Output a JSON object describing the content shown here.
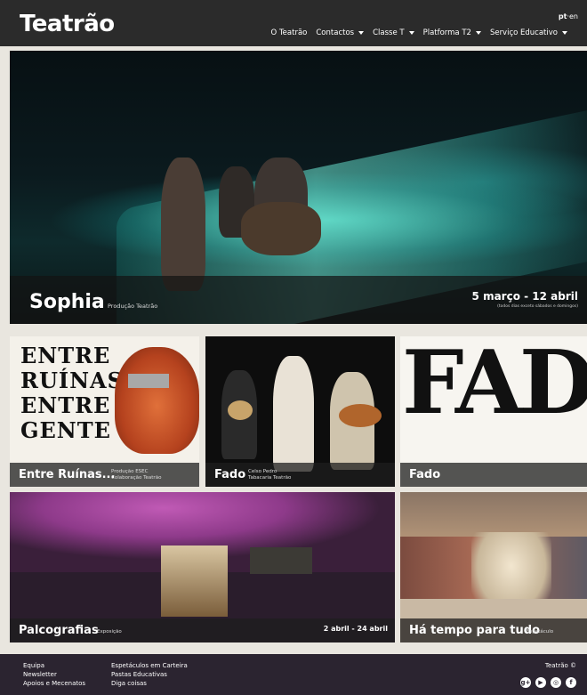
{
  "header": {
    "logo": "Teatrão",
    "lang_active": "pt",
    "lang_sep": "·",
    "lang_other": "en",
    "nav": [
      {
        "label": "O Teatrão",
        "dropdown": false
      },
      {
        "label": "Contactos",
        "dropdown": true
      },
      {
        "label": "Classe T",
        "dropdown": true
      },
      {
        "label": "Platforma T2",
        "dropdown": true
      },
      {
        "label": "Serviço Educativo",
        "dropdown": true
      }
    ]
  },
  "hero": {
    "title": "Sophia",
    "subtitle": "Produção Teatrão",
    "dates": "5 março - 12 abril",
    "note": "(todos dias exceto sábados e domingos)"
  },
  "cards": [
    {
      "title": "Entre Ruínas...",
      "subtitle_line1": "Produção ESEC",
      "subtitle_line2": "Colaboração Teatrão",
      "art_text": "ENTRE\nRUÍNAS,\nENTRE\nGENTE"
    },
    {
      "title": "Fado",
      "subtitle_line1": "Celso Pedro",
      "subtitle_line2": "Tabacaria Teatrão"
    },
    {
      "title": "Fado",
      "art_text": "FADO"
    },
    {
      "title": "Palcografias",
      "subtitle_line1": "Exposição",
      "dates": "2 abril - 24 abril"
    },
    {
      "title": "Há tempo para tudo",
      "subtitle_line1": "Espetáculo"
    }
  ],
  "footer": {
    "col1": [
      "Equipa",
      "Newsletter",
      "Apoios e Mecenatos"
    ],
    "col2": [
      "Espetáculos em Carteira",
      "Pastas Educativas",
      "Diga coisas"
    ],
    "copyright": "Teatrão ©",
    "social_icons": [
      "google-plus-icon",
      "youtube-icon",
      "instagram-icon",
      "facebook-icon"
    ]
  },
  "colors": {
    "header_bg": "#2b2b2b",
    "page_bg": "#e9e6df",
    "footer_bg": "#2b2430",
    "caption_overlay": "rgba(30,30,30,0.75)"
  }
}
